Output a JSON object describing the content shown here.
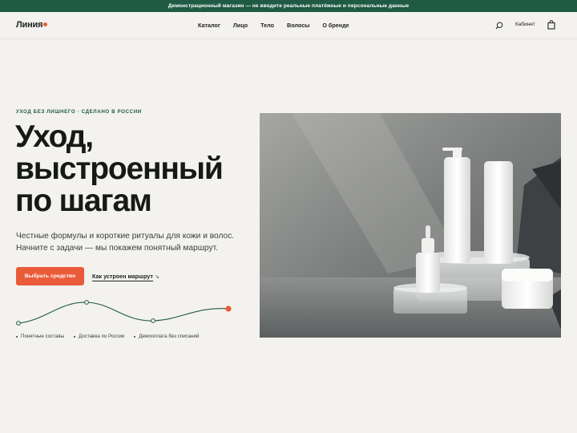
{
  "demo_banner": "Демонстрационный магазин — не вводите реальные платёжные и персональные данные",
  "header": {
    "logo": "Линия",
    "nav": [
      "Каталог",
      "Лицо",
      "Тело",
      "Волосы",
      "О бренде"
    ],
    "account": "Кабинет"
  },
  "hero": {
    "eyebrow": "УХОД БЕЗ ЛИШНЕГО · СДЕЛАНО В РОССИИ",
    "headline": "Уход, выстроенный по шагам",
    "lead_line1": "Честные формулы и короткие ритуалы для кожи и волос.",
    "lead_line2": "Начните с задачи — мы покажем понятный маршрут.",
    "cta": "Выбрать средство",
    "secondary_link": "Как устроен маршрут",
    "bullets": [
      "Понятные составы",
      "Доставка по России",
      "Демооплата без списаний"
    ]
  },
  "colors": {
    "accent": "#ea5b3a",
    "brand_green": "#1f5a44",
    "background": "#f3f2ee"
  }
}
